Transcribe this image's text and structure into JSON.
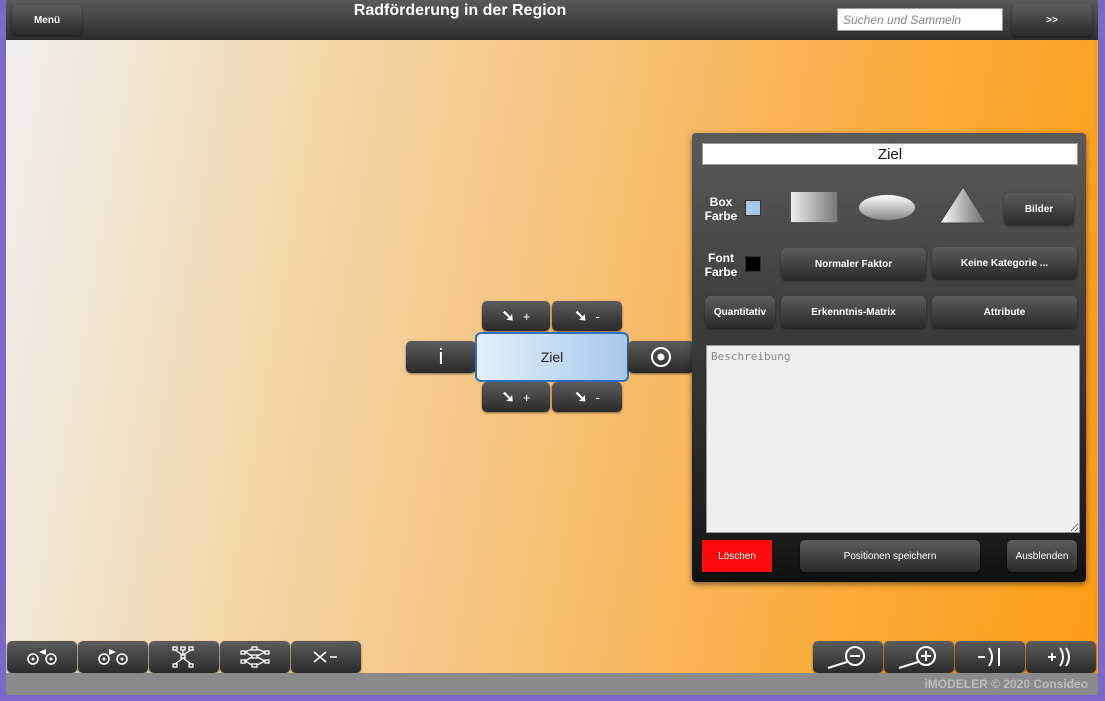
{
  "header": {
    "menu_label": "Menü",
    "title": "Radförderung in der Region",
    "search_placeholder": "Suchen und Sammeln",
    "expand_label": ">>"
  },
  "node": {
    "label": "Ziel",
    "info_label": "i",
    "add_cause_label": "+",
    "remove_cause_label": "-",
    "add_effect_label": "+",
    "remove_effect_label": "-"
  },
  "panel": {
    "title_value": "Ziel",
    "box_color_label_1": "Box",
    "box_color_label_2": "Farbe",
    "font_color_label_1": "Font",
    "font_color_label_2": "Farbe",
    "box_color": "#a7c9ea",
    "font_color": "#000000",
    "images_label": "Bilder",
    "factor_label": "Normaler Faktor",
    "category_label": "Keine Kategorie ...",
    "quantitative_label": "Quantitativ",
    "matrix_label": "Erkenntnis-Matrix",
    "attributes_label": "Attribute",
    "description_placeholder": "Beschreibung",
    "delete_label": "Löschen",
    "save_positions_label": "Positionen speichern",
    "hide_label": "Ausblenden"
  },
  "footer": {
    "copyright": "iMODELER © 2020 Consideo"
  },
  "colors": {
    "accent_delete": "#ff0a0a",
    "node_border": "#2a6fc2",
    "frame": "#7b68c8"
  }
}
